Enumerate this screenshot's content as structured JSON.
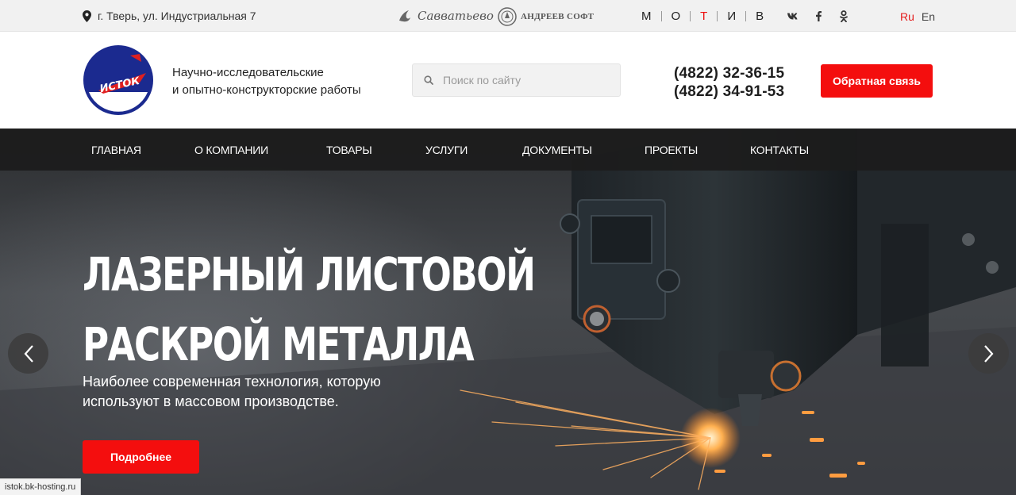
{
  "topbar": {
    "address": "г. Тверь, ул. Индустриальная 7",
    "partners": {
      "savvatyevo": "Савватьево",
      "andreev": "АНДРЕЕВ СОФТ",
      "motiv_letters": [
        "М",
        "О",
        "Т",
        "И",
        "В"
      ]
    },
    "social_icons": [
      "vk-icon",
      "facebook-icon",
      "odnoklassniki-icon"
    ],
    "languages": {
      "ru": "Ru",
      "en": "En",
      "active": "Ru"
    }
  },
  "header": {
    "logo_text": "ИСТОК",
    "tagline_line1": "Научно-исследовательские",
    "tagline_line2": "и опытно-конструкторские работы",
    "search_placeholder": "Поиск по сайту",
    "phone1": "(4822) 32-36-15",
    "phone2": "(4822) 34-91-53",
    "callback_label": "Обратная связь"
  },
  "nav": {
    "items": [
      {
        "label": "ГЛАВНАЯ"
      },
      {
        "label": "О КОМПАНИИ"
      },
      {
        "label": "ТОВАРЫ"
      },
      {
        "label": "УСЛУГИ"
      },
      {
        "label": "ДОКУМЕНТЫ"
      },
      {
        "label": "ПРОЕКТЫ"
      },
      {
        "label": "КОНТАКТЫ"
      }
    ]
  },
  "hero": {
    "title_line1": "Лазерный листовой",
    "title_line2": "раскрой металла",
    "subtitle_line1": "Наиболее современная технология, которую",
    "subtitle_line2": "используют в массовом производстве.",
    "button_label": "Подробнее"
  },
  "status_url": "istok.bk-hosting.ru",
  "colors": {
    "accent": "#f40e0e",
    "logo_blue": "#1b2a8f",
    "nav_bg": "#1c1c1c",
    "topbar_bg": "#f1f1f1"
  }
}
